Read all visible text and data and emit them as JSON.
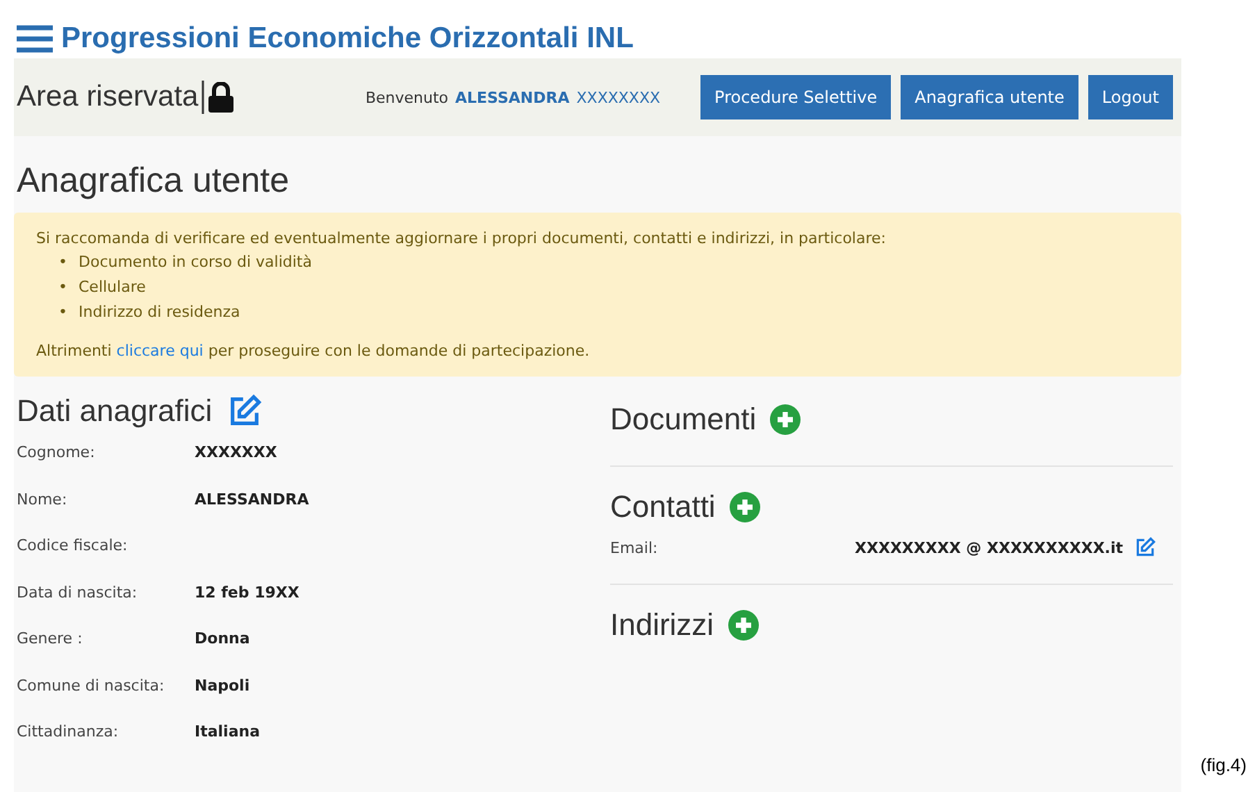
{
  "doc_title": "Progressioni Economiche Orizzontali INL",
  "header": {
    "area": "Area riservata",
    "welcome": "Benvenuto",
    "user_name": "ALESSANDRA",
    "user_surname": "XXXXXXXX",
    "nav": [
      "Procedure Selettive",
      "Anagrafica utente",
      "Logout"
    ]
  },
  "page_title": "Anagrafica utente",
  "alert": {
    "marker": "•",
    "intro": "Si raccomanda di verificare ed eventualmente aggiornare i propri documenti, contatti e indirizzi, in particolare:",
    "items": [
      "Documento in corso di validità",
      "Cellulare",
      "Indirizzo di residenza"
    ],
    "before_link": "Altrimenti",
    "link": "cliccare qui",
    "after_link": "per proseguire con le domande di partecipazione."
  },
  "personal": {
    "title": "Dati anagrafici",
    "fields": [
      {
        "label": "Cognome:",
        "value": "XXXXXXX"
      },
      {
        "label": "Nome:",
        "value": "ALESSANDRA"
      },
      {
        "label": "Codice fiscale:"
      },
      {
        "label": "Data di nascita:",
        "value": "12 feb 19XX"
      },
      {
        "label": "Genere :",
        "value": "Donna"
      },
      {
        "label": "Comune di nascita:",
        "value": "Napoli"
      },
      {
        "label": "Cittadinanza:",
        "value": "Italiana"
      }
    ]
  },
  "sections": [
    {
      "title": "Documenti"
    },
    {
      "title": "Contatti",
      "fields": [
        {
          "label": "Email:",
          "value": "XXXXXXXXX @ XXXXXXXXXX.it"
        }
      ]
    },
    {
      "title": "Indirizzi"
    }
  ],
  "caption": "(fig.4)"
}
